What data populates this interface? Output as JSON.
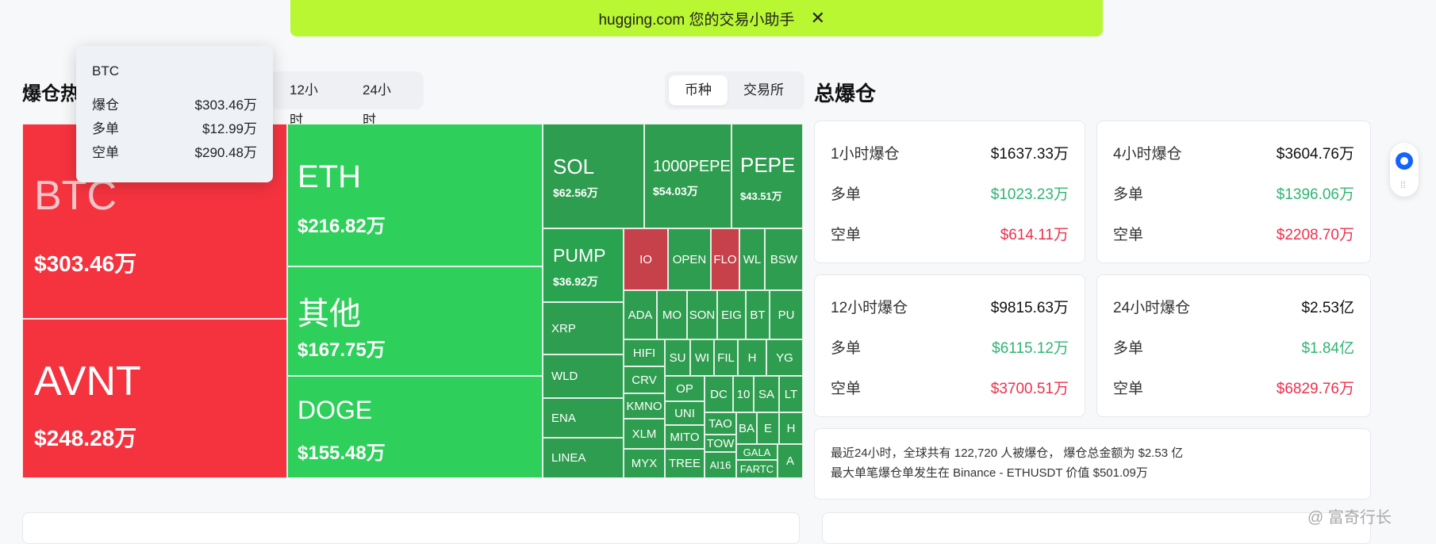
{
  "banner": {
    "text": "hugging.com 您的交易小助手",
    "close": "✕"
  },
  "heatmap": {
    "title": "爆仓热",
    "time_tabs": [
      "12小时",
      "24小时"
    ],
    "group_tabs": [
      "币种",
      "交易所"
    ]
  },
  "tooltip": {
    "symbol": "BTC",
    "rows": [
      {
        "label": "爆仓",
        "value": "$303.46万"
      },
      {
        "label": "多单",
        "value": "$12.99万"
      },
      {
        "label": "空单",
        "value": "$290.48万"
      }
    ]
  },
  "treemap": {
    "btc": {
      "symbol": "BTC",
      "value": "$303.46万"
    },
    "avnt": {
      "symbol": "AVNT",
      "value": "$248.28万"
    },
    "eth": {
      "symbol": "ETH",
      "value": "$216.82万"
    },
    "other": {
      "symbol": "其他",
      "value": "$167.75万"
    },
    "doge": {
      "symbol": "DOGE",
      "value": "$155.48万"
    },
    "sol": {
      "symbol": "SOL",
      "value": "$62.56万"
    },
    "pepe1000": {
      "symbol": "1000PEPE",
      "value": "$54.03万"
    },
    "pepe": {
      "symbol": "PEPE",
      "value": "$43.51万"
    },
    "pump": {
      "symbol": "PUMP",
      "value": "$36.92万"
    },
    "small": {
      "io": "IO",
      "open": "OPEN",
      "flo": "FLO",
      "wl": "WL",
      "bsw": "BSW",
      "xrp": "XRP",
      "ada": "ADA",
      "mo": "MO",
      "son": "SON",
      "eig": "EIG",
      "bt": "BT",
      "pu": "PU",
      "wld": "WLD",
      "hifi": "HIFI",
      "su": "SU",
      "wi": "WI",
      "fil": "FIL",
      "h": "H",
      "yg": "YG",
      "crv": "CRV",
      "op": "OP",
      "dc": "DC",
      "n10": "10",
      "sa": "SA",
      "lt": "LT",
      "ena": "ENA",
      "kmno": "KMNO",
      "uni": "UNI",
      "tao": "TAO",
      "ba": "BA",
      "e": "E",
      "h2": "H",
      "xlm": "XLM",
      "mito": "MITO",
      "tow": "TOW",
      "gala": "GALA",
      "linea": "LINEA",
      "myx": "MYX",
      "tree": "TREE",
      "ai16": "AI16",
      "farto": "FARTC",
      "a": "A"
    }
  },
  "total": {
    "title": "总爆仓",
    "cards": [
      {
        "title": "1小时爆仓",
        "total": "$1637.33万",
        "long_label": "多单",
        "long": "$1023.23万",
        "short_label": "空单",
        "short": "$614.11万"
      },
      {
        "title": "4小时爆仓",
        "total": "$3604.76万",
        "long_label": "多单",
        "long": "$1396.06万",
        "short_label": "空单",
        "short": "$2208.70万"
      },
      {
        "title": "12小时爆仓",
        "total": "$9815.63万",
        "long_label": "多单",
        "long": "$6115.12万",
        "short_label": "空单",
        "short": "$3700.51万"
      },
      {
        "title": "24小时爆仓",
        "total": "$2.53亿",
        "long_label": "多单",
        "long": "$1.84亿",
        "short_label": "空单",
        "short": "$6829.76万"
      }
    ],
    "summary_line1": "最近24小时，全球共有 122,720 人被爆仓， 爆仓总金额为 $2.53 亿",
    "summary_line2": "最大单笔爆仓单发生在 Binance - ETHUSDT 价值 $501.09万"
  },
  "watermark": "@ 富奇行长",
  "colors": {
    "liq_red": "#f5333f",
    "liq_green": "#2fcf5c",
    "long_green": "#2fb572",
    "short_red": "#f0304b",
    "banner": "#b8f731"
  }
}
